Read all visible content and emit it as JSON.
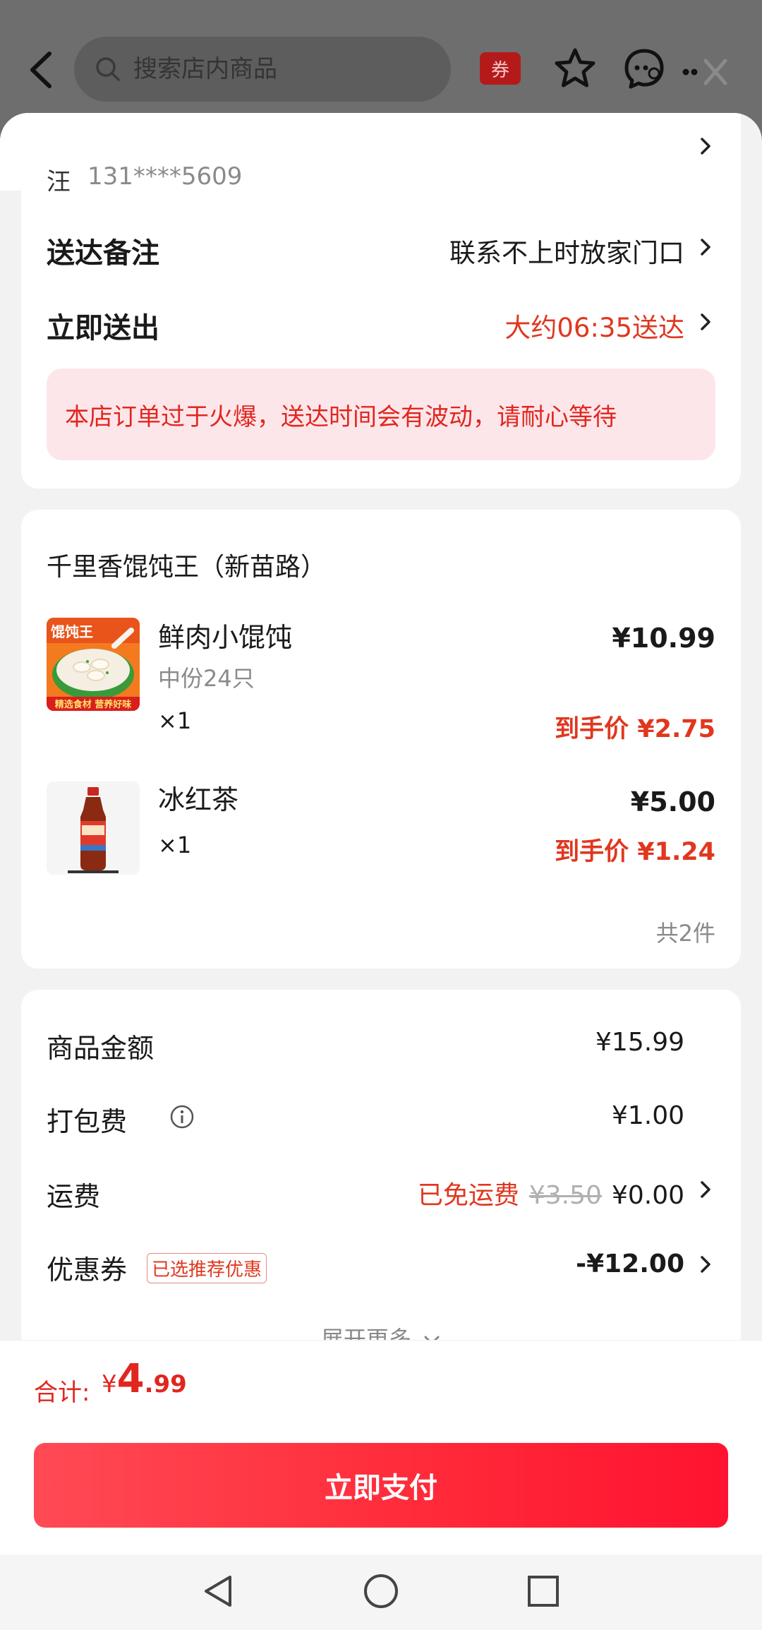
{
  "header": {
    "search_placeholder": "搜索店内商品",
    "coupon_badge": "券",
    "icons": [
      "back-arrow-icon",
      "search-icon",
      "star-icon",
      "customer-service-icon",
      "more-icon",
      "close-icon"
    ]
  },
  "address": {
    "name": "汪",
    "phone": "131****5609"
  },
  "delivery": {
    "note_label": "送达备注",
    "note_value": "联系不上时放家门口",
    "time_label": "立即送出",
    "time_value": "大约06:35送达",
    "notice": "本店订单过于火爆，送达时间会有波动，请耐心等待"
  },
  "order": {
    "shop_name": "千里香馄饨王（新苗路）",
    "items": [
      {
        "name": "鲜肉小馄饨",
        "spec": "中份24只",
        "qty": "×1",
        "price": "¥10.99",
        "final_price": "到手价 ¥2.75",
        "thumb_badge": "馄饨王",
        "thumb_ribbon": "精选食材  营养好味"
      },
      {
        "name": "冰红茶",
        "qty": "×1",
        "price": "¥5.00",
        "final_price": "到手价 ¥1.24"
      }
    ],
    "count": "共2件"
  },
  "fees": {
    "goods_label": "商品金额",
    "goods_value": "¥15.99",
    "packing_label": "打包费",
    "packing_value": "¥1.00",
    "shipping_label": "运费",
    "shipping_free": "已免运费",
    "shipping_original": "¥3.50",
    "shipping_value": "¥0.00",
    "coupon_label": "优惠券",
    "coupon_tag": "已选推荐优惠",
    "coupon_value": "-¥12.00",
    "expand": "展开更多"
  },
  "total": {
    "label": "合计:",
    "currency": "¥",
    "integer": "4",
    "decimal": ".99"
  },
  "pay_button": "立即支付",
  "colors": {
    "accent_red": "#e0371f",
    "notice_bg": "#fde6ea",
    "pay_gradient_start": "#ff4a55",
    "pay_gradient_end": "#ff1330"
  }
}
